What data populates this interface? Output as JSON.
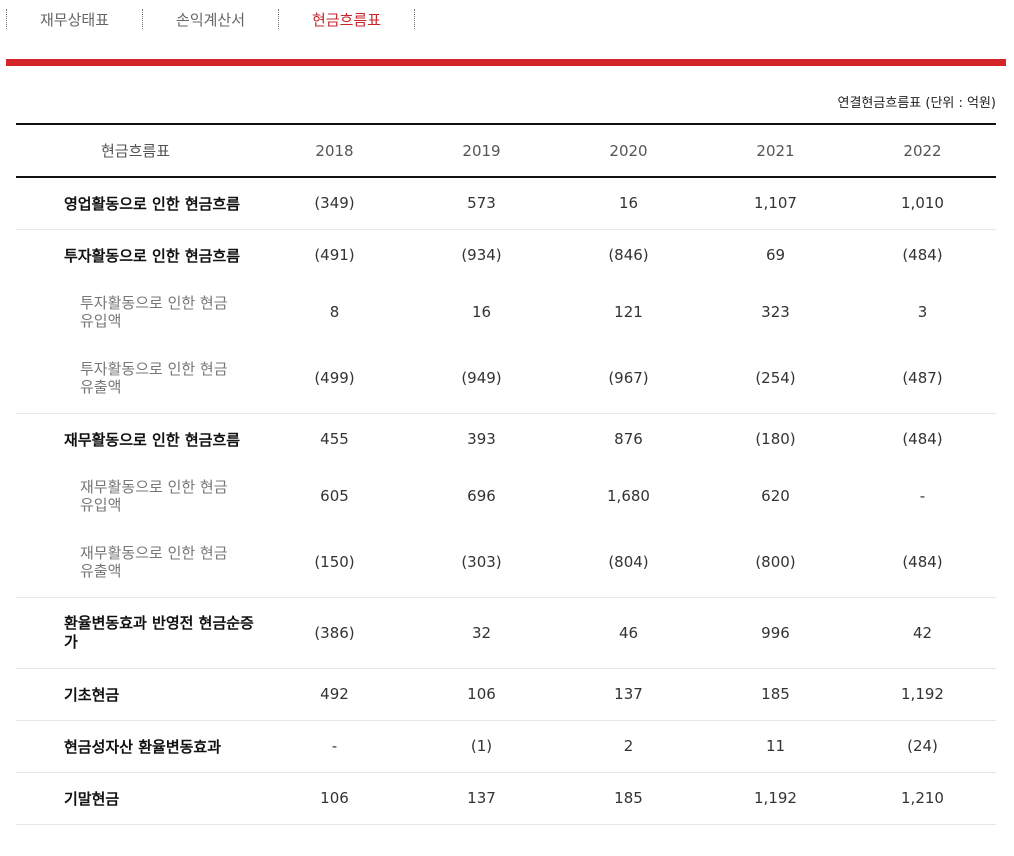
{
  "tabs": [
    {
      "label": "재무상태표",
      "active": false
    },
    {
      "label": "손익계산서",
      "active": false
    },
    {
      "label": "현금흐름표",
      "active": true
    }
  ],
  "unit_note": "연결현금흐름표 (단위 : 억원)",
  "table": {
    "header": [
      "현금흐름표",
      "2018",
      "2019",
      "2020",
      "2021",
      "2022"
    ],
    "rows": [
      {
        "label": "영업활동으로 인한 현금흐름",
        "values": [
          "(349)",
          "573",
          "16",
          "1,107",
          "1,010"
        ]
      },
      {
        "label": "투자활동으로 인한 현금흐름",
        "values": [
          "(491)",
          "(934)",
          "(846)",
          "69",
          "(484)"
        ]
      },
      {
        "label": "투자활동으로 인한 현금유입액",
        "values": [
          "8",
          "16",
          "121",
          "323",
          "3"
        ]
      },
      {
        "label": "투자활동으로 인한 현금유출액",
        "values": [
          "(499)",
          "(949)",
          "(967)",
          "(254)",
          "(487)"
        ]
      },
      {
        "label": "재무활동으로 인한 현금흐름",
        "values": [
          "455",
          "393",
          "876",
          "(180)",
          "(484)"
        ]
      },
      {
        "label": "재무활동으로 인한 현금유입액",
        "values": [
          "605",
          "696",
          "1,680",
          "620",
          "-"
        ]
      },
      {
        "label": "재무활동으로 인한 현금유출액",
        "values": [
          "(150)",
          "(303)",
          "(804)",
          "(800)",
          "(484)"
        ]
      },
      {
        "label": "환율변동효과 반영전 현금순증가",
        "values": [
          "(386)",
          "32",
          "46",
          "996",
          "42"
        ]
      },
      {
        "label": "기초현금",
        "values": [
          "492",
          "106",
          "137",
          "185",
          "1,192"
        ]
      },
      {
        "label": "현금성자산 환율변동효과",
        "values": [
          "-",
          "(1)",
          "2",
          "11",
          "(24)"
        ]
      },
      {
        "label": "기말현금",
        "values": [
          "106",
          "137",
          "185",
          "1,192",
          "1,210"
        ]
      }
    ]
  }
}
